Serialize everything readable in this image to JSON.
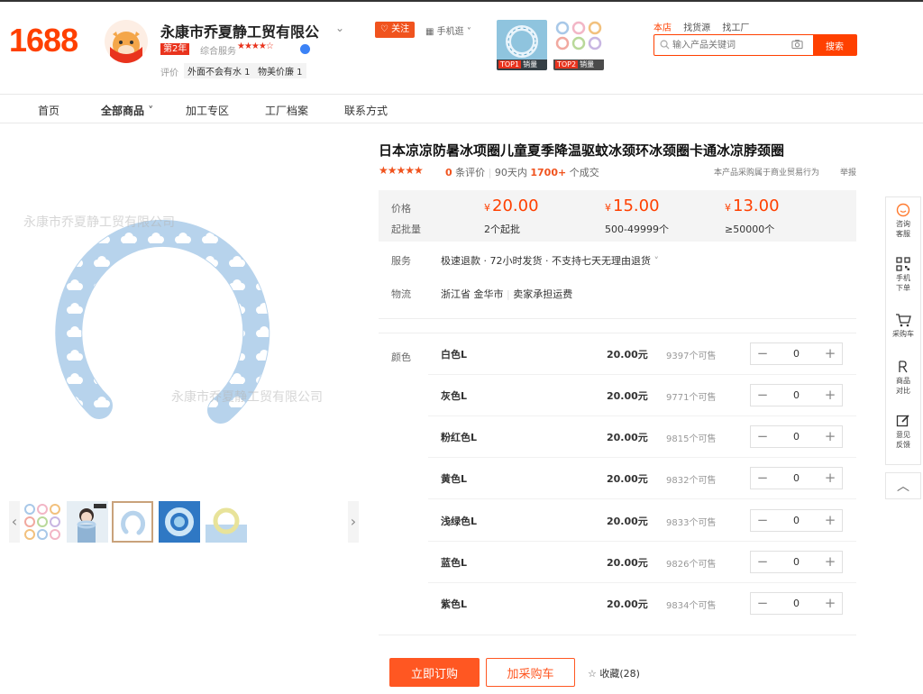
{
  "header": {
    "logo": "1688",
    "shop_name": "永康市乔夏静工贸有限公",
    "year_badge": "第2年",
    "rating_label": "综合服务",
    "rating_stars": "★★★★☆",
    "eval_label": "评价",
    "eval_tags": [
      "外面不会有水 1",
      "物美价廉 1"
    ],
    "follow_label": "关注",
    "mobile_link": "手机逛",
    "top_badges": [
      {
        "rank": "TOP1",
        "text": "销量"
      },
      {
        "rank": "TOP2",
        "text": "销量"
      }
    ],
    "search_scopes": [
      "本店",
      "找货源",
      "找工厂"
    ],
    "search_placeholder": "输入产品关键词",
    "search_button": "搜索"
  },
  "nav": {
    "items": [
      "首页",
      "全部商品",
      "加工专区",
      "工厂档案",
      "联系方式"
    ]
  },
  "gallery": {
    "watermark": "永康市乔夏静工贸有限公司",
    "selected_thumb": 3
  },
  "product": {
    "title": "日本凉凉防暑冰项圈儿童夏季降温驱蚊冰颈环冰颈圈卡通冰凉脖颈圈",
    "stars": "★★★★★",
    "review_count": "0",
    "review_label": "条评价",
    "sales_period": "90天内",
    "sales_count": "1700+",
    "sales_label": "个成交",
    "biz_note": "本产品采购属于商业贸易行为",
    "report": "举报",
    "price_label": "价格",
    "moq_label": "起批量",
    "currency": "¥",
    "tiers": [
      {
        "price": "20.00",
        "moq": "2个起批"
      },
      {
        "price": "15.00",
        "moq": "500-49999个"
      },
      {
        "price": "13.00",
        "moq": "≥50000个"
      }
    ],
    "service_label": "服务",
    "service_text": "极速退款 · 72小时发货 · 不支持七天无理由退货",
    "logistics_label": "物流",
    "logistics_from": "浙江省 金华市",
    "logistics_fee": "卖家承担运费",
    "color_label": "颜色",
    "variants": [
      {
        "name": "白色L",
        "price": "20.00元",
        "stock": "9397个可售",
        "qty": "0"
      },
      {
        "name": "灰色L",
        "price": "20.00元",
        "stock": "9771个可售",
        "qty": "0"
      },
      {
        "name": "粉红色L",
        "price": "20.00元",
        "stock": "9815个可售",
        "qty": "0"
      },
      {
        "name": "黄色L",
        "price": "20.00元",
        "stock": "9832个可售",
        "qty": "0"
      },
      {
        "name": "浅绿色L",
        "price": "20.00元",
        "stock": "9833个可售",
        "qty": "0"
      },
      {
        "name": "蓝色L",
        "price": "20.00元",
        "stock": "9826个可售",
        "qty": "0"
      },
      {
        "name": "紫色L",
        "price": "20.00元",
        "stock": "9834个可售",
        "qty": "0"
      }
    ],
    "buy_now": "立即订购",
    "add_cart": "加采购车",
    "favorite": "收藏(28)"
  },
  "sidebar": {
    "items": [
      "咨询客服",
      "手机下单",
      "采购车",
      "商品对比",
      "意见反馈"
    ]
  },
  "colors": {
    "brand": "#ff4000",
    "accent": "#ff5722",
    "ring": "#b7d3ec"
  }
}
